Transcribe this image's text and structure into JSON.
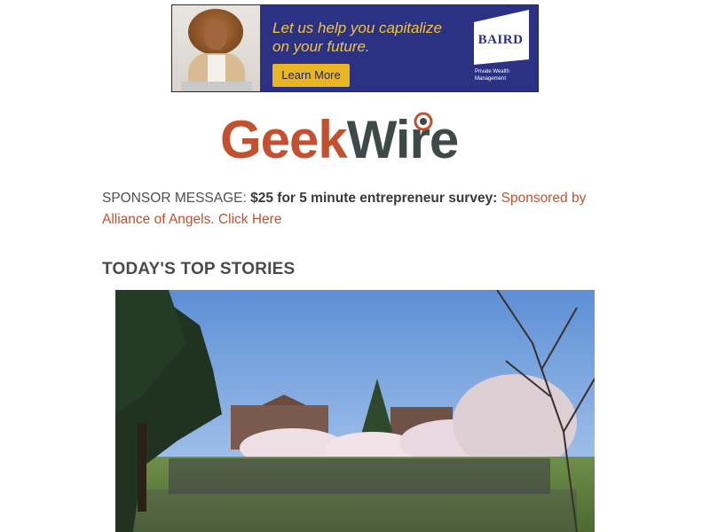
{
  "ad": {
    "headline": "Let us help you capitalize\non your future.",
    "button_label": "Learn More",
    "brand": "BAIRD",
    "brand_sub": "Private Wealth\nManagement",
    "colors": {
      "background": "#2b3183",
      "headline": "#f2c53d",
      "button": "#eab522"
    }
  },
  "logo": {
    "part1": "Geek",
    "part2": "Wire",
    "colors": {
      "geek": "#c3512f",
      "wire": "#3d4a47"
    }
  },
  "sponsor": {
    "lead": "SPONSOR MESSAGE:",
    "bold": "$25 for 5 minute entrepreneur survey:",
    "link": "Sponsored by Alliance of Angels. Click Here",
    "link_color": "#c3512f"
  },
  "section": {
    "title": "TODAY'S TOP STORIES"
  },
  "story": {
    "image_icon": "campus-photo"
  }
}
